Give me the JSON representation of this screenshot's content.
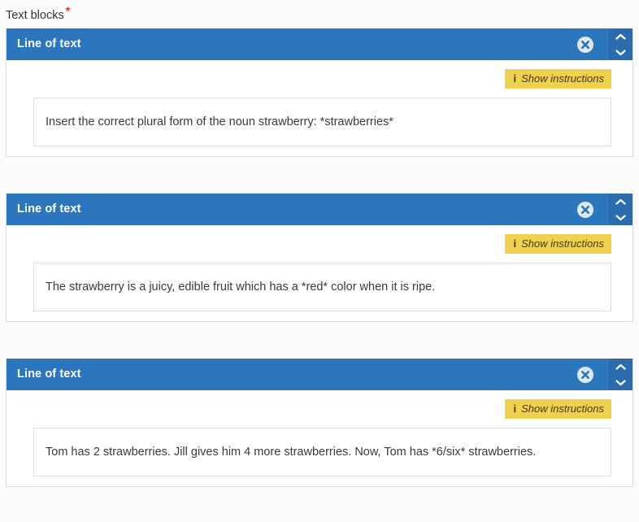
{
  "field": {
    "label": "Text blocks",
    "required_marker": "*"
  },
  "icons": {
    "close": "close-circle-icon",
    "move_up": "chevron-up-icon",
    "move_down": "chevron-down-icon",
    "info": "info-icon"
  },
  "colors": {
    "header_blue": "#2b76bd",
    "move_column_blue": "#2a6cae",
    "instructions_yellow": "#efd14f",
    "required_red": "#d9352c",
    "panel_border": "#dcdcdc"
  },
  "common": {
    "instructions_label": "Show instructions",
    "info_glyph": "i"
  },
  "blocks": [
    {
      "title": "Line of text",
      "instructions_label": "Show instructions",
      "value": "Insert the correct plural form of the noun strawberry: *strawberries*"
    },
    {
      "title": "Line of text",
      "instructions_label": "Show instructions",
      "value": "The strawberry is a juicy, edible fruit which has a *red* color when it is ripe."
    },
    {
      "title": "Line of text",
      "instructions_label": "Show instructions",
      "value": "Tom has 2 strawberries. Jill gives him 4 more strawberries. Now, Tom has *6/six* strawberries."
    }
  ]
}
